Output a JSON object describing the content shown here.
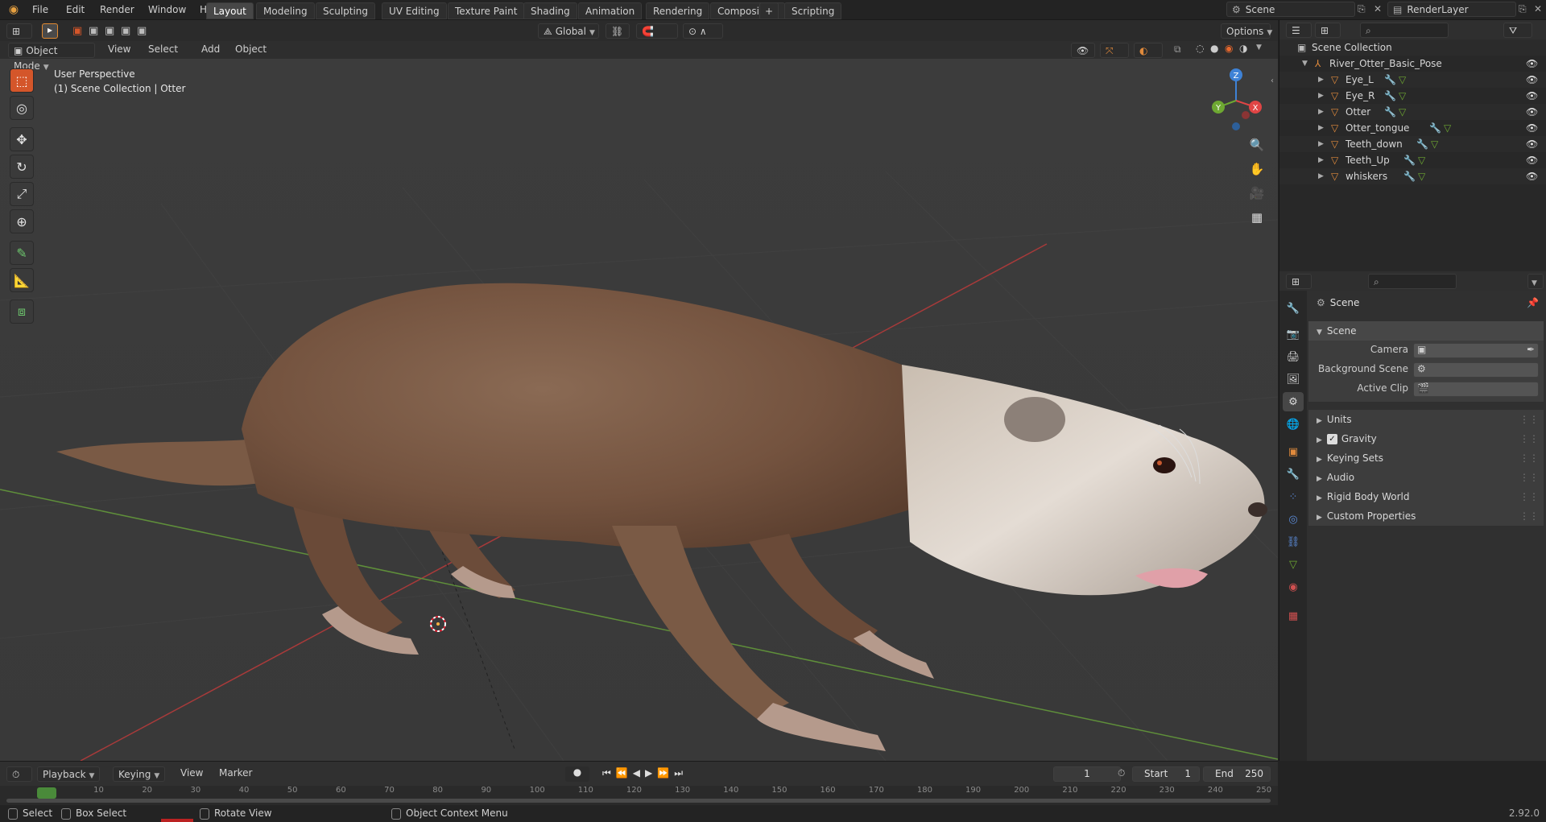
{
  "menus": [
    "File",
    "Edit",
    "Render",
    "Window",
    "Help"
  ],
  "workspaces": [
    "Layout",
    "Modeling",
    "Sculpting",
    "UV Editing",
    "Texture Paint",
    "Shading",
    "Animation",
    "Rendering",
    "Compositing",
    "Scripting"
  ],
  "active_workspace": "Layout",
  "scene_field": "Scene",
  "renderlayer_field": "RenderLayer",
  "header": {
    "transform_orientation": "Global",
    "options_label": "Options"
  },
  "viewport_header": {
    "mode": "Object Mode",
    "menus": [
      "View",
      "Select",
      "Add",
      "Object"
    ]
  },
  "viewport": {
    "perspective_label": "User Perspective",
    "collection_label": "(1) Scene Collection | Otter"
  },
  "gizmo_axes": {
    "x": "X",
    "y": "Y",
    "z": "Z"
  },
  "outliner": {
    "root": "Scene Collection",
    "collection": "River_Otter_Basic_Pose",
    "objects": [
      "Eye_L",
      "Eye_R",
      "Otter",
      "Otter_tongue",
      "Teeth_down",
      "Teeth_Up",
      "whiskers"
    ]
  },
  "properties": {
    "context": "Scene",
    "panel_title": "Scene",
    "fields": {
      "camera": "Camera",
      "background_scene": "Background Scene",
      "active_clip": "Active Clip"
    },
    "collapsed_panels": [
      "Units",
      "Gravity",
      "Keying Sets",
      "Audio",
      "Rigid Body World",
      "Custom Properties"
    ]
  },
  "timeline": {
    "menus": [
      "Playback",
      "Keying",
      "View",
      "Marker"
    ],
    "current_frame": "1",
    "start_label": "Start",
    "start": "1",
    "end_label": "End",
    "end": "250",
    "ticks": [
      "0",
      "10",
      "20",
      "30",
      "40",
      "50",
      "60",
      "70",
      "80",
      "90",
      "100",
      "110",
      "120",
      "130",
      "140",
      "150",
      "160",
      "170",
      "180",
      "190",
      "200",
      "210",
      "220",
      "230",
      "240",
      "250"
    ]
  },
  "statusbar": {
    "select": "Select",
    "box_select": "Box Select",
    "rotate_view": "Rotate View",
    "context_menu": "Object Context Menu",
    "version": "2.92.0"
  },
  "colors": {
    "accent": "#d4562a",
    "axis_x": "#e04545",
    "axis_y": "#6ea832",
    "axis_z": "#3e82d6",
    "object_icon": "#e08a3c"
  }
}
